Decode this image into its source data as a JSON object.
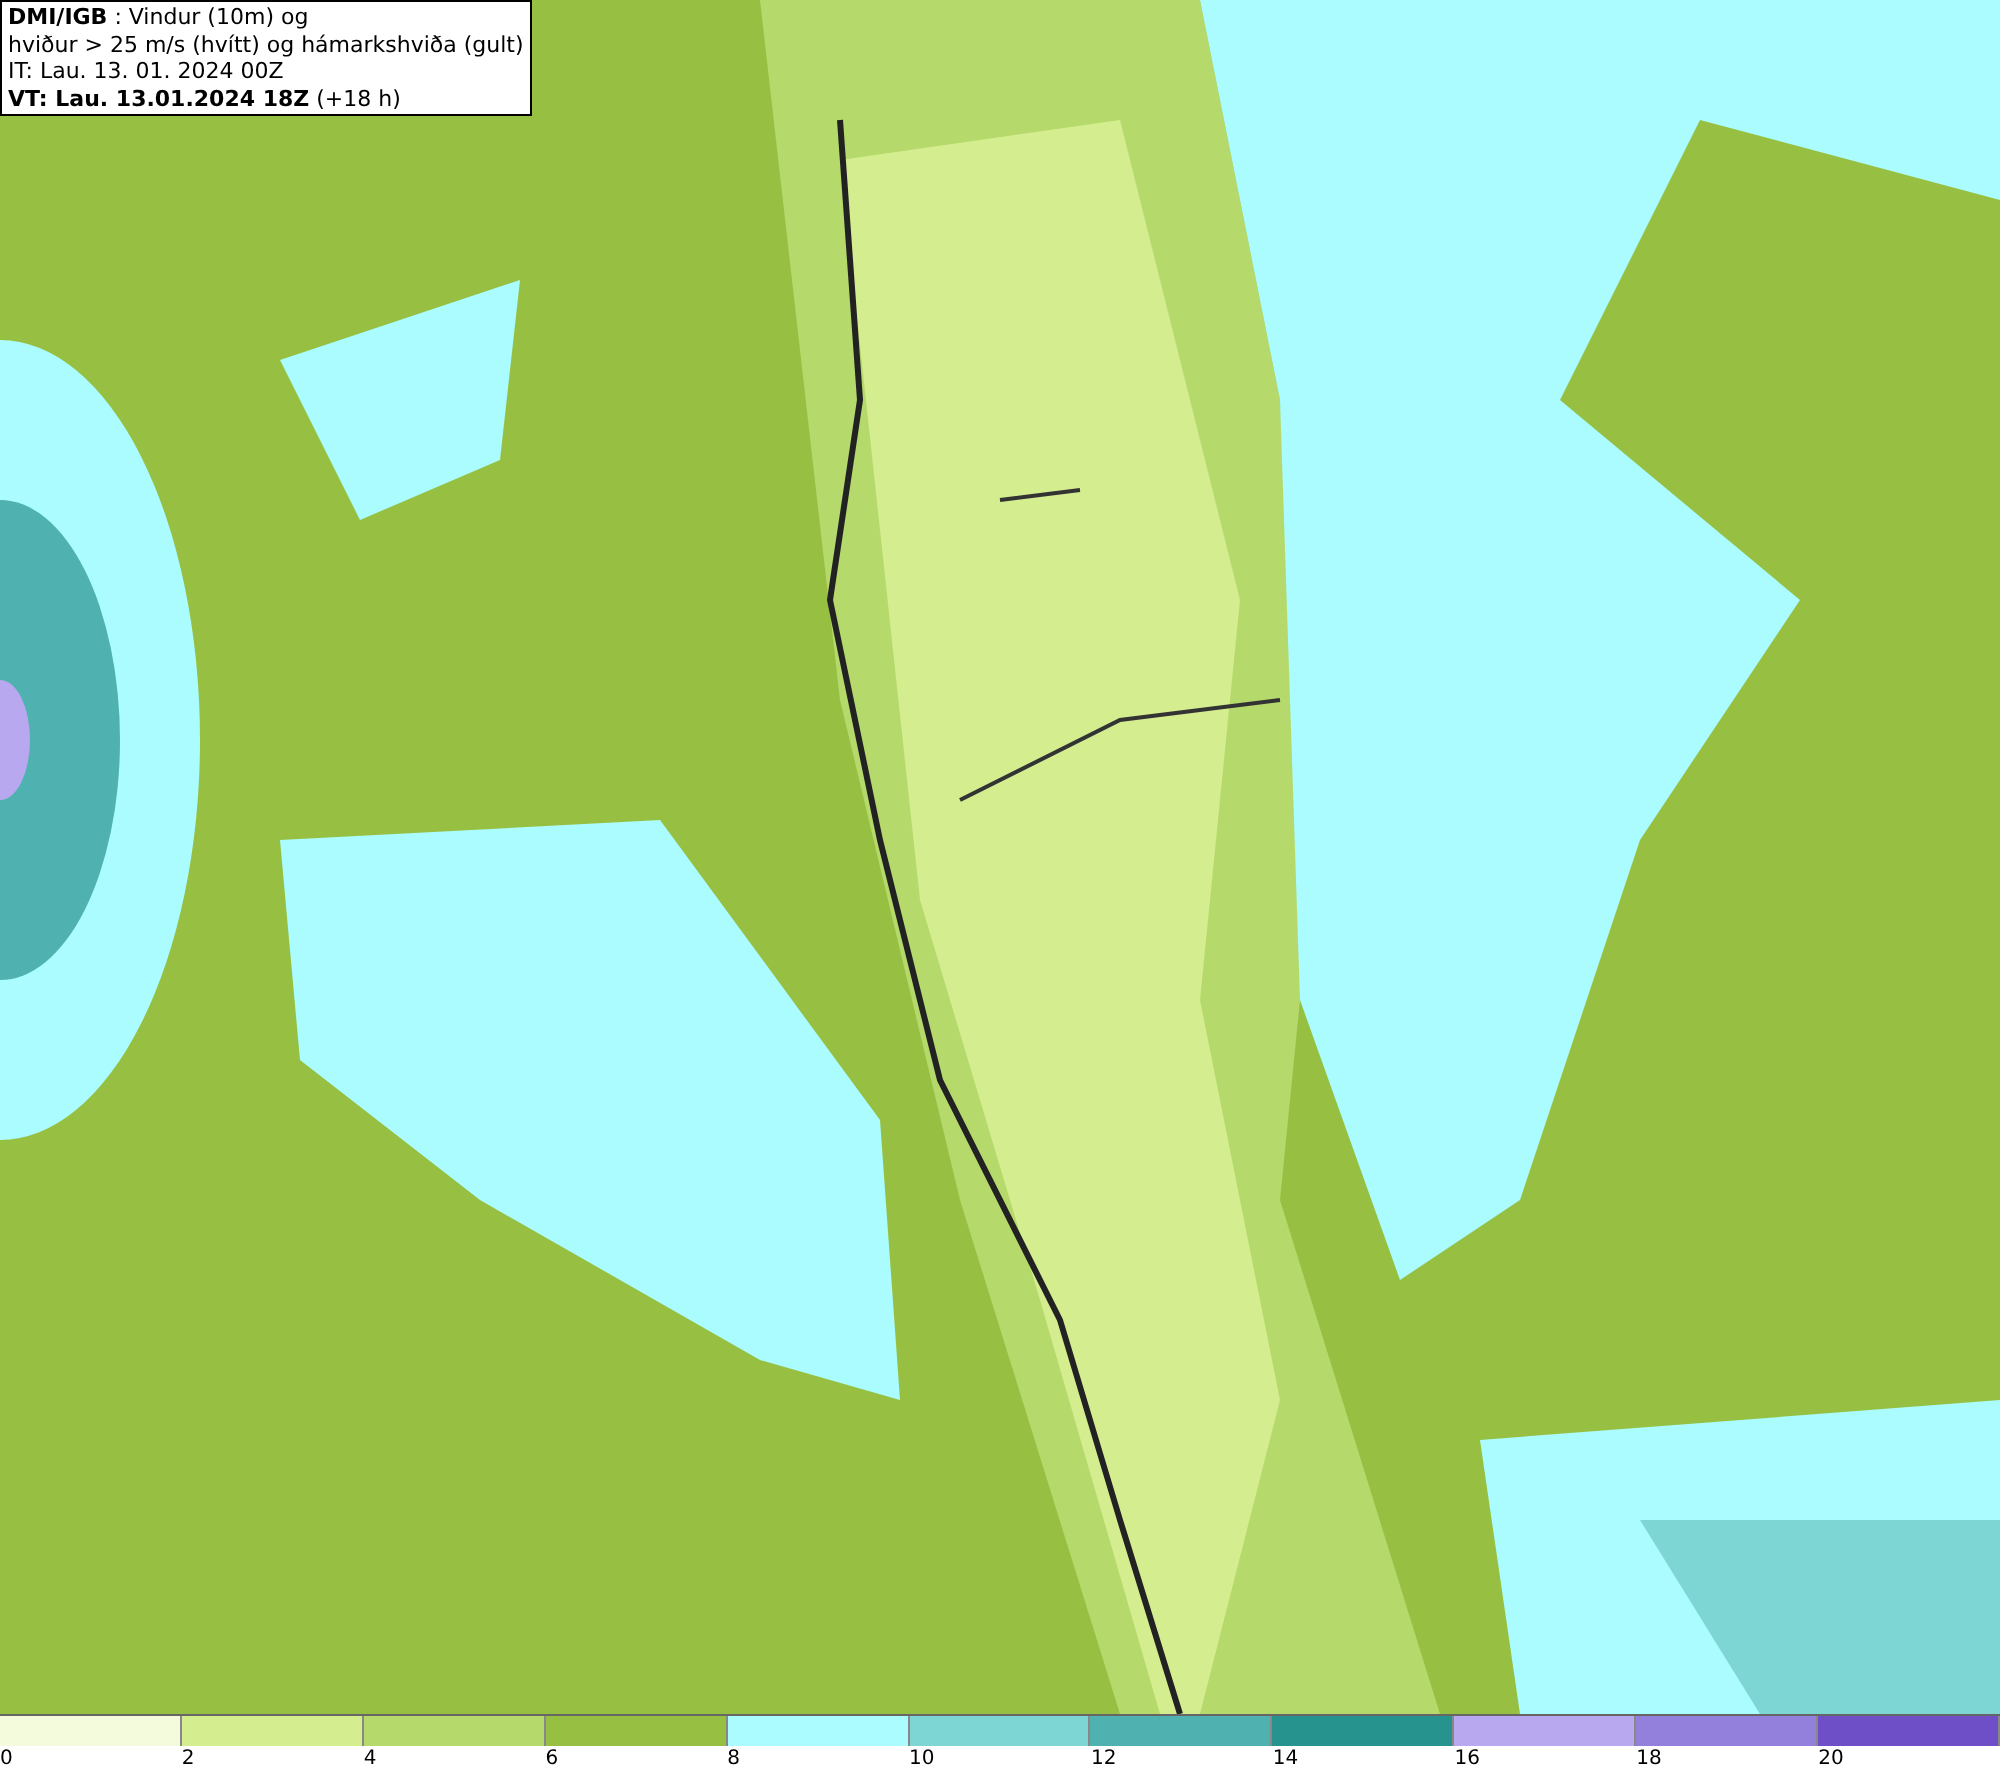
{
  "header": {
    "lines": [
      "**DMI/IGB** : Vindur (10m) og",
      "hviður > 25 m/s (hvítt) og hámarkshviða (gult)",
      "IT: Lau. 13. 01. 2024 00Z",
      "**VT: Lau. 13.01.2024 18Z** (+18 h)"
    ]
  },
  "legend": [
    {
      "label": "0",
      "color": "#f3fbdc"
    },
    {
      "label": "2",
      "color": "#d4ed8f"
    },
    {
      "label": "4",
      "color": "#b5d96b"
    },
    {
      "label": "6",
      "color": "#97c043"
    },
    {
      "label": "8",
      "color": "#aafcff"
    },
    {
      "label": "10",
      "color": "#7dd5d4"
    },
    {
      "label": "12",
      "color": "#4fb2b0"
    },
    {
      "label": "14",
      "color": "#26938f"
    },
    {
      "label": "16",
      "color": "#b8a8f0"
    },
    {
      "label": "18",
      "color": "#9280dc"
    },
    {
      "label": "20",
      "color": "#6f4fc8"
    }
  ]
}
